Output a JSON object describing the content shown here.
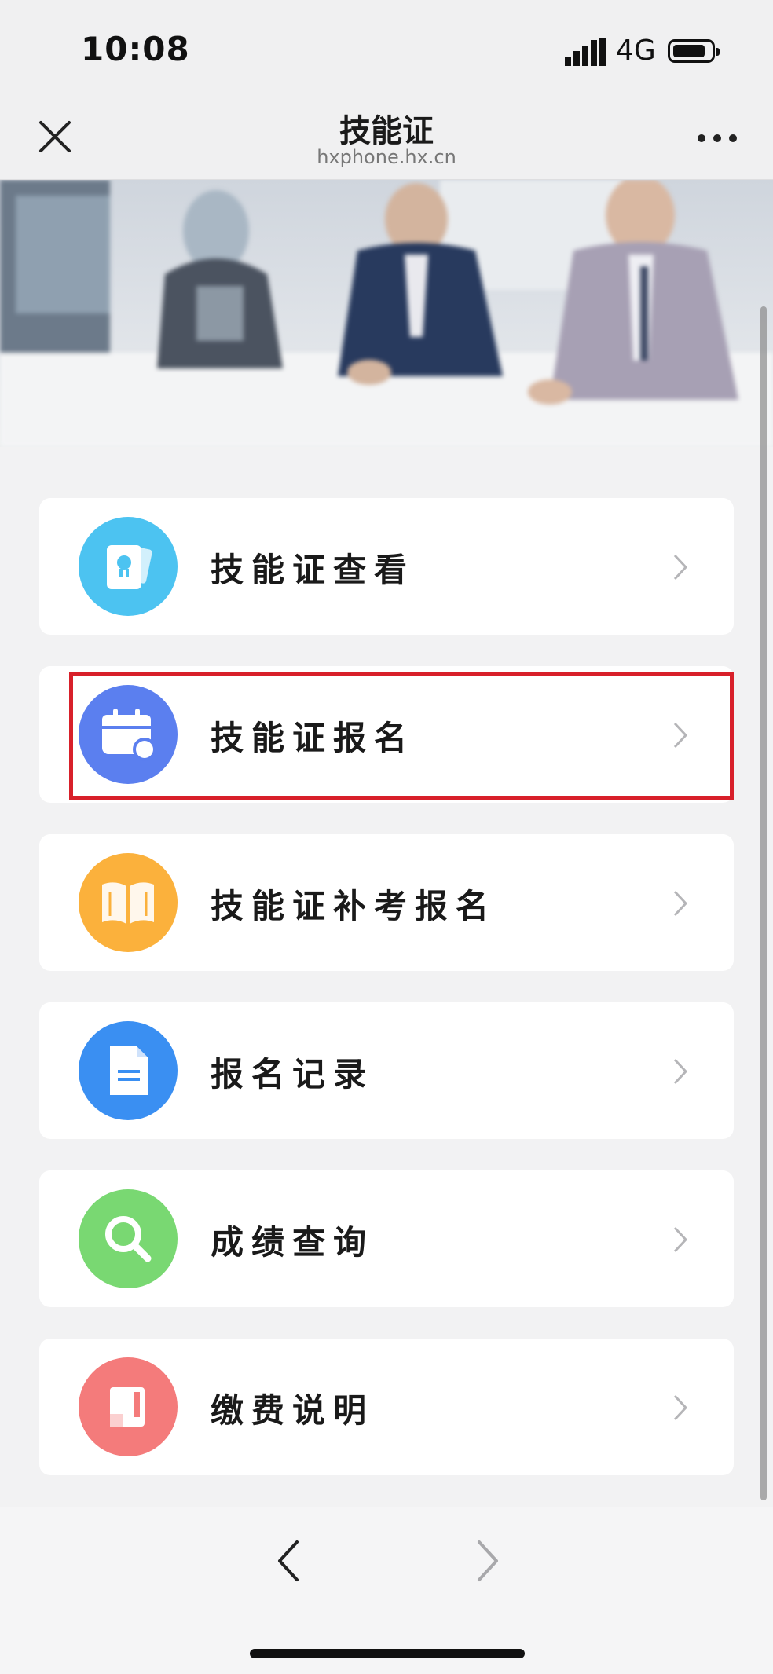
{
  "status_bar": {
    "time": "10:08",
    "network": "4G"
  },
  "nav": {
    "title": "技能证",
    "subtitle": "hxphone.hx.cn"
  },
  "menu": [
    {
      "label": "技能证查看",
      "icon": "certificate-icon",
      "color": "#4cc3f1"
    },
    {
      "label": "技能证报名",
      "icon": "calendar-icon",
      "color": "#5b7fef",
      "highlighted": true
    },
    {
      "label": "技能证补考报名",
      "icon": "book-icon",
      "color": "#fbb13c"
    },
    {
      "label": "报名记录",
      "icon": "document-icon",
      "color": "#3a8ff2"
    },
    {
      "label": "成绩查询",
      "icon": "search-icon",
      "color": "#79d872"
    },
    {
      "label": "缴费说明",
      "icon": "receipt-icon",
      "color": "#f47b7b"
    }
  ],
  "highlight_color": "#d8202a"
}
